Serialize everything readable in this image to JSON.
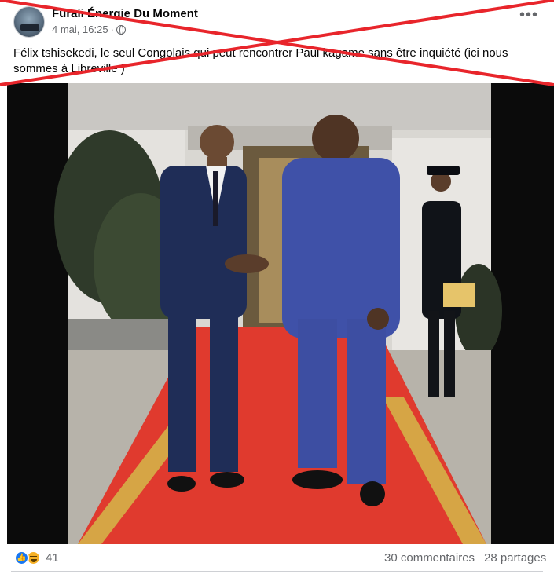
{
  "post": {
    "page_name": "Furaii Énergie Du Moment",
    "date": "4 mai, 16:25",
    "separator": "·",
    "caption": "Félix tshisekedi, le seul Congolais qui peut rencontrer Paul kagame sans être inquiété   (ici nous sommes à Libreville )",
    "more_label": "•••",
    "photo_alt": "Photo",
    "x_mark_color": "#e8252b"
  },
  "footer": {
    "reaction_icons": [
      "like-icon",
      "haha-icon"
    ],
    "reaction_count": "41",
    "comments": "30 commentaires",
    "shares": "28 partages"
  },
  "colors": {
    "accent": "#1877f2",
    "secondary_text": "#65676b",
    "carpet": "#e03a2e",
    "suit_dark": "#1f2d57",
    "suit_blue": "#3f51a8"
  }
}
